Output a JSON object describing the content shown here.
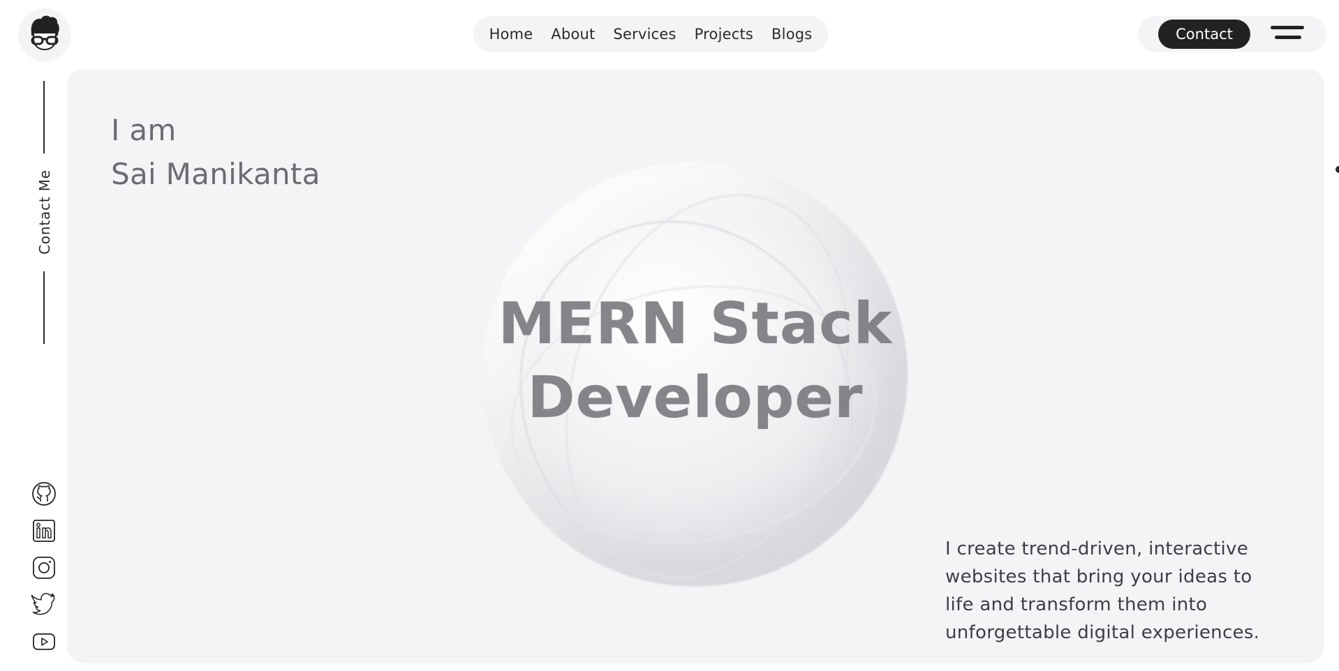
{
  "nav": {
    "logo_icon": "developer-avatar-icon",
    "links": [
      "Home",
      "About",
      "Services",
      "Projects",
      "Blogs"
    ],
    "contact_label": "Contact",
    "menu_icon": "hamburger-menu-icon"
  },
  "sidebar": {
    "contact_me_label": "Contact Me",
    "socials": [
      "github-icon",
      "linkedin-icon",
      "instagram-icon",
      "twitter-icon",
      "youtube-icon"
    ]
  },
  "hero": {
    "intro_line1": "I am",
    "intro_line2": "Sai Manikanta",
    "headline_line1": "MERN Stack",
    "headline_line2": "Developer",
    "tagline": "I create trend-driven, interactive websites that bring your ideas to life and transform them into unforgettable digital experiences."
  },
  "colors": {
    "background": "#ffffff",
    "panel": "#f4f4f7",
    "accent_dark": "#222222",
    "text_muted": "#6b6b72"
  }
}
